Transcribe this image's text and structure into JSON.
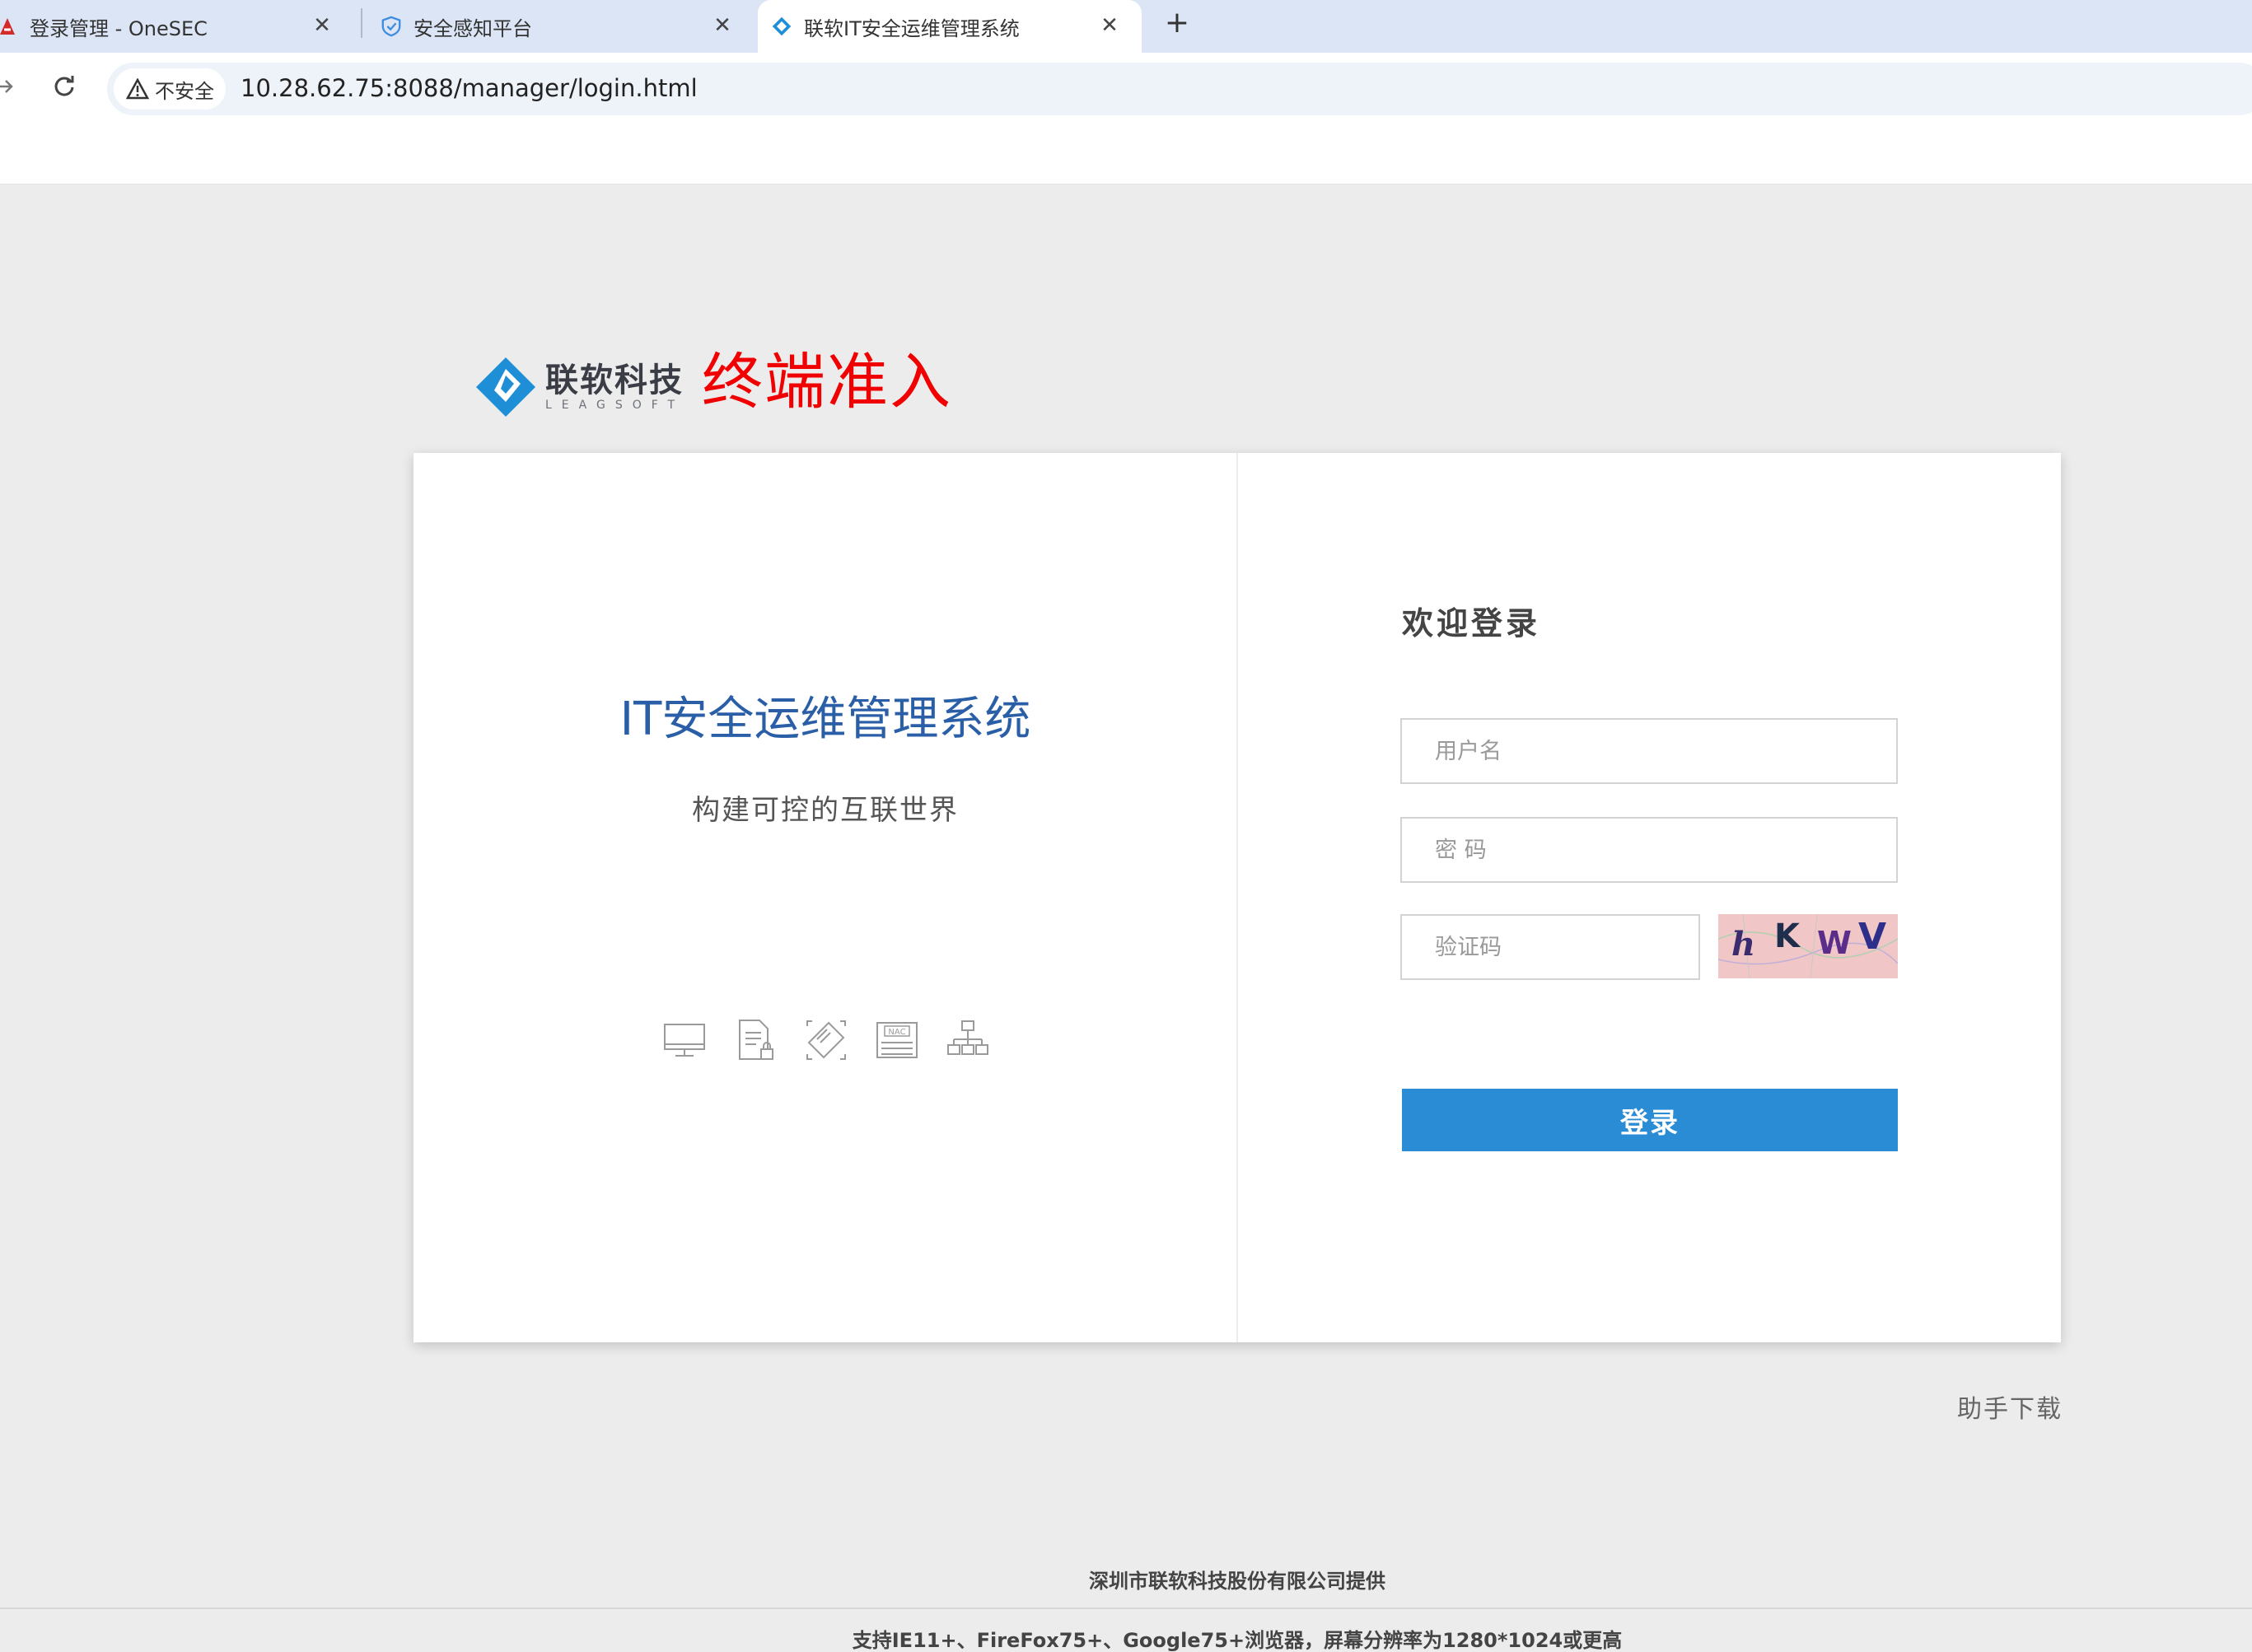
{
  "browser": {
    "tabs": [
      {
        "title": "登录管理 - OneSEC",
        "icon": "onesec-logo-icon"
      },
      {
        "title": "安全感知平台",
        "icon": "shield-icon"
      },
      {
        "title": "联软IT安全运维管理系统",
        "icon": "leagsoft-logo-icon",
        "active": true
      }
    ],
    "tab_close": "✕",
    "new_tab": "+",
    "security_label": "不安全",
    "url": "10.28.62.75:8088/manager/login.html"
  },
  "brand": {
    "name_cn": "联软科技",
    "name_en": "LEAGSOFT",
    "logo_color": "#1e8fd6"
  },
  "annotation": "终端准入",
  "left_panel": {
    "title": "IT安全运维管理系统",
    "subtitle": "构建可控的互联世界",
    "feature_icons": [
      "monitor-icon",
      "document-lock-icon",
      "usb-drive-icon",
      "nac-icon",
      "network-topology-icon"
    ]
  },
  "login": {
    "welcome": "欢迎登录",
    "username_placeholder": "用户名",
    "password_placeholder": "密 码",
    "captcha_placeholder": "验证码",
    "captcha_text": "hKWV",
    "button": "登录"
  },
  "download_link": "助手下载",
  "footer": {
    "company": "深圳市联软科技股份有限公司提供",
    "support": "支持IE11+、FireFox75+、Google75+浏览器，屏幕分辨率为1280*1024或更高"
  },
  "colors": {
    "accent": "#2a8cd5",
    "title_blue": "#2a5fa8",
    "annotation_red": "#f00000"
  }
}
